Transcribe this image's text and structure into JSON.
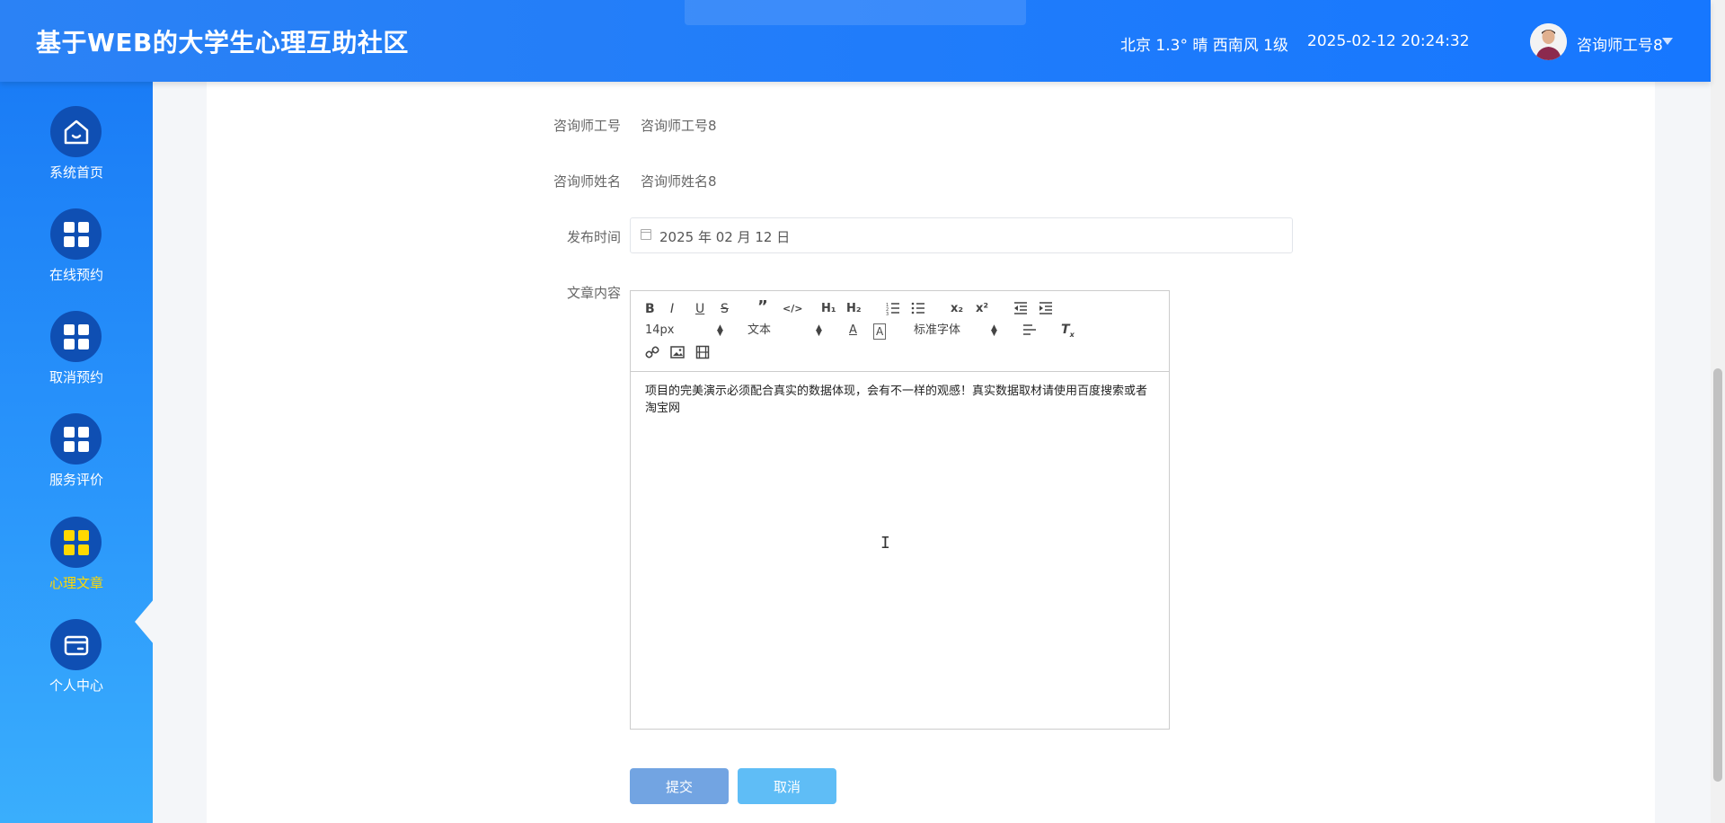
{
  "header": {
    "title": "基于WEB的大学生心理互助社区",
    "weather": "北京 1.3° 晴 西南风 1级",
    "datetime": "2025-02-12 20:24:32",
    "username": "咨询师工号8"
  },
  "sidebar": {
    "items": [
      {
        "label": "系统首页",
        "icon": "home-icon"
      },
      {
        "label": "在线预约",
        "icon": "grid-icon"
      },
      {
        "label": "取消预约",
        "icon": "grid-icon"
      },
      {
        "label": "服务评价",
        "icon": "grid-icon"
      },
      {
        "label": "心理文章",
        "icon": "grid-icon",
        "active": true
      },
      {
        "label": "个人中心",
        "icon": "card-icon"
      }
    ]
  },
  "form": {
    "counselor_id_label": "咨询师工号",
    "counselor_id_value": "咨询师工号8",
    "counselor_name_label": "咨询师姓名",
    "counselor_name_value": "咨询师姓名8",
    "publish_time_label": "发布时间",
    "publish_time_value": "2025 年 02 月 12 日",
    "content_label": "文章内容"
  },
  "editor": {
    "font_size": "14px",
    "header_select": "文本",
    "font_family": "标准字体",
    "body_text": "项目的完美演示必须配合真实的数据体现，会有不一样的观感！真实数据取材请使用百度搜索或者淘宝网"
  },
  "buttons": {
    "submit": "提交",
    "cancel": "取消"
  },
  "colors": {
    "header_bg": "#1677ff",
    "sidebar_bg": "#2a96fb",
    "active_nav": "#ffd900",
    "submit_btn": "#72a4e2",
    "cancel_btn": "#5fbdf6"
  }
}
